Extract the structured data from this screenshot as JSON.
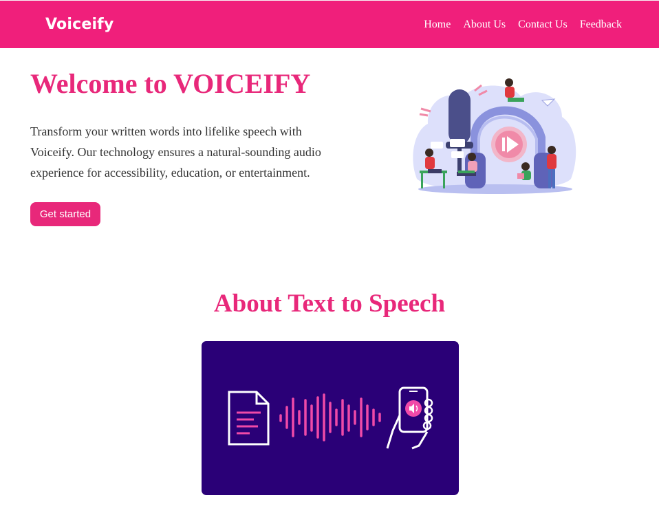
{
  "nav": {
    "brand": "Voiceify",
    "links": [
      {
        "label": "Home"
      },
      {
        "label": "About Us"
      },
      {
        "label": "Contact Us"
      },
      {
        "label": "Feedback"
      }
    ]
  },
  "hero": {
    "title": "Welcome to VOICEIFY",
    "description": "Transform your written words into lifelike speech with Voiceify. Our technology ensures a natural-sounding audio experience for accessibility, education, or entertainment.",
    "cta_label": "Get started",
    "illustration": "podcast-headphones-illustration"
  },
  "about": {
    "title": "About Text to Speech",
    "image": "text-to-speech-illustration"
  },
  "colors": {
    "brand_pink": "#f01f7b",
    "heading_pink": "#e8287a",
    "card_purple": "#2a0077",
    "accent_pink": "#f04aa8"
  }
}
